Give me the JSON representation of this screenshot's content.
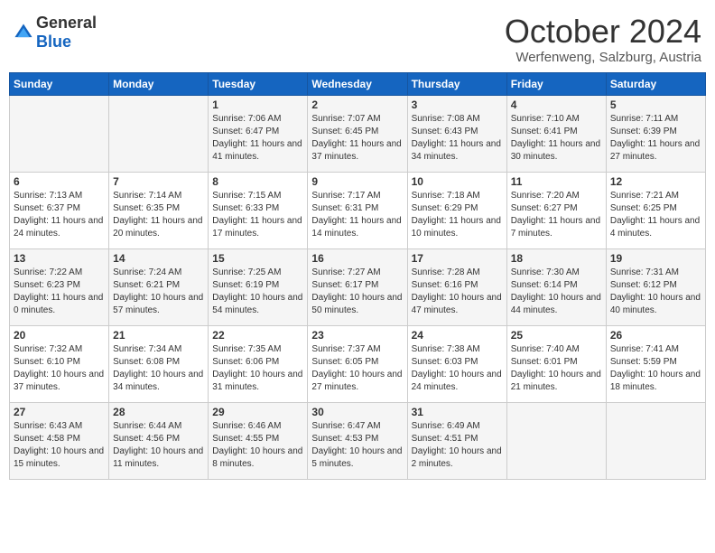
{
  "header": {
    "logo_general": "General",
    "logo_blue": "Blue",
    "month": "October 2024",
    "location": "Werfenweng, Salzburg, Austria"
  },
  "days_of_week": [
    "Sunday",
    "Monday",
    "Tuesday",
    "Wednesday",
    "Thursday",
    "Friday",
    "Saturday"
  ],
  "weeks": [
    [
      {
        "day": "",
        "sunrise": "",
        "sunset": "",
        "daylight": ""
      },
      {
        "day": "",
        "sunrise": "",
        "sunset": "",
        "daylight": ""
      },
      {
        "day": "1",
        "sunrise": "Sunrise: 7:06 AM",
        "sunset": "Sunset: 6:47 PM",
        "daylight": "Daylight: 11 hours and 41 minutes."
      },
      {
        "day": "2",
        "sunrise": "Sunrise: 7:07 AM",
        "sunset": "Sunset: 6:45 PM",
        "daylight": "Daylight: 11 hours and 37 minutes."
      },
      {
        "day": "3",
        "sunrise": "Sunrise: 7:08 AM",
        "sunset": "Sunset: 6:43 PM",
        "daylight": "Daylight: 11 hours and 34 minutes."
      },
      {
        "day": "4",
        "sunrise": "Sunrise: 7:10 AM",
        "sunset": "Sunset: 6:41 PM",
        "daylight": "Daylight: 11 hours and 30 minutes."
      },
      {
        "day": "5",
        "sunrise": "Sunrise: 7:11 AM",
        "sunset": "Sunset: 6:39 PM",
        "daylight": "Daylight: 11 hours and 27 minutes."
      }
    ],
    [
      {
        "day": "6",
        "sunrise": "Sunrise: 7:13 AM",
        "sunset": "Sunset: 6:37 PM",
        "daylight": "Daylight: 11 hours and 24 minutes."
      },
      {
        "day": "7",
        "sunrise": "Sunrise: 7:14 AM",
        "sunset": "Sunset: 6:35 PM",
        "daylight": "Daylight: 11 hours and 20 minutes."
      },
      {
        "day": "8",
        "sunrise": "Sunrise: 7:15 AM",
        "sunset": "Sunset: 6:33 PM",
        "daylight": "Daylight: 11 hours and 17 minutes."
      },
      {
        "day": "9",
        "sunrise": "Sunrise: 7:17 AM",
        "sunset": "Sunset: 6:31 PM",
        "daylight": "Daylight: 11 hours and 14 minutes."
      },
      {
        "day": "10",
        "sunrise": "Sunrise: 7:18 AM",
        "sunset": "Sunset: 6:29 PM",
        "daylight": "Daylight: 11 hours and 10 minutes."
      },
      {
        "day": "11",
        "sunrise": "Sunrise: 7:20 AM",
        "sunset": "Sunset: 6:27 PM",
        "daylight": "Daylight: 11 hours and 7 minutes."
      },
      {
        "day": "12",
        "sunrise": "Sunrise: 7:21 AM",
        "sunset": "Sunset: 6:25 PM",
        "daylight": "Daylight: 11 hours and 4 minutes."
      }
    ],
    [
      {
        "day": "13",
        "sunrise": "Sunrise: 7:22 AM",
        "sunset": "Sunset: 6:23 PM",
        "daylight": "Daylight: 11 hours and 0 minutes."
      },
      {
        "day": "14",
        "sunrise": "Sunrise: 7:24 AM",
        "sunset": "Sunset: 6:21 PM",
        "daylight": "Daylight: 10 hours and 57 minutes."
      },
      {
        "day": "15",
        "sunrise": "Sunrise: 7:25 AM",
        "sunset": "Sunset: 6:19 PM",
        "daylight": "Daylight: 10 hours and 54 minutes."
      },
      {
        "day": "16",
        "sunrise": "Sunrise: 7:27 AM",
        "sunset": "Sunset: 6:17 PM",
        "daylight": "Daylight: 10 hours and 50 minutes."
      },
      {
        "day": "17",
        "sunrise": "Sunrise: 7:28 AM",
        "sunset": "Sunset: 6:16 PM",
        "daylight": "Daylight: 10 hours and 47 minutes."
      },
      {
        "day": "18",
        "sunrise": "Sunrise: 7:30 AM",
        "sunset": "Sunset: 6:14 PM",
        "daylight": "Daylight: 10 hours and 44 minutes."
      },
      {
        "day": "19",
        "sunrise": "Sunrise: 7:31 AM",
        "sunset": "Sunset: 6:12 PM",
        "daylight": "Daylight: 10 hours and 40 minutes."
      }
    ],
    [
      {
        "day": "20",
        "sunrise": "Sunrise: 7:32 AM",
        "sunset": "Sunset: 6:10 PM",
        "daylight": "Daylight: 10 hours and 37 minutes."
      },
      {
        "day": "21",
        "sunrise": "Sunrise: 7:34 AM",
        "sunset": "Sunset: 6:08 PM",
        "daylight": "Daylight: 10 hours and 34 minutes."
      },
      {
        "day": "22",
        "sunrise": "Sunrise: 7:35 AM",
        "sunset": "Sunset: 6:06 PM",
        "daylight": "Daylight: 10 hours and 31 minutes."
      },
      {
        "day": "23",
        "sunrise": "Sunrise: 7:37 AM",
        "sunset": "Sunset: 6:05 PM",
        "daylight": "Daylight: 10 hours and 27 minutes."
      },
      {
        "day": "24",
        "sunrise": "Sunrise: 7:38 AM",
        "sunset": "Sunset: 6:03 PM",
        "daylight": "Daylight: 10 hours and 24 minutes."
      },
      {
        "day": "25",
        "sunrise": "Sunrise: 7:40 AM",
        "sunset": "Sunset: 6:01 PM",
        "daylight": "Daylight: 10 hours and 21 minutes."
      },
      {
        "day": "26",
        "sunrise": "Sunrise: 7:41 AM",
        "sunset": "Sunset: 5:59 PM",
        "daylight": "Daylight: 10 hours and 18 minutes."
      }
    ],
    [
      {
        "day": "27",
        "sunrise": "Sunrise: 6:43 AM",
        "sunset": "Sunset: 4:58 PM",
        "daylight": "Daylight: 10 hours and 15 minutes."
      },
      {
        "day": "28",
        "sunrise": "Sunrise: 6:44 AM",
        "sunset": "Sunset: 4:56 PM",
        "daylight": "Daylight: 10 hours and 11 minutes."
      },
      {
        "day": "29",
        "sunrise": "Sunrise: 6:46 AM",
        "sunset": "Sunset: 4:55 PM",
        "daylight": "Daylight: 10 hours and 8 minutes."
      },
      {
        "day": "30",
        "sunrise": "Sunrise: 6:47 AM",
        "sunset": "Sunset: 4:53 PM",
        "daylight": "Daylight: 10 hours and 5 minutes."
      },
      {
        "day": "31",
        "sunrise": "Sunrise: 6:49 AM",
        "sunset": "Sunset: 4:51 PM",
        "daylight": "Daylight: 10 hours and 2 minutes."
      },
      {
        "day": "",
        "sunrise": "",
        "sunset": "",
        "daylight": ""
      },
      {
        "day": "",
        "sunrise": "",
        "sunset": "",
        "daylight": ""
      }
    ]
  ]
}
